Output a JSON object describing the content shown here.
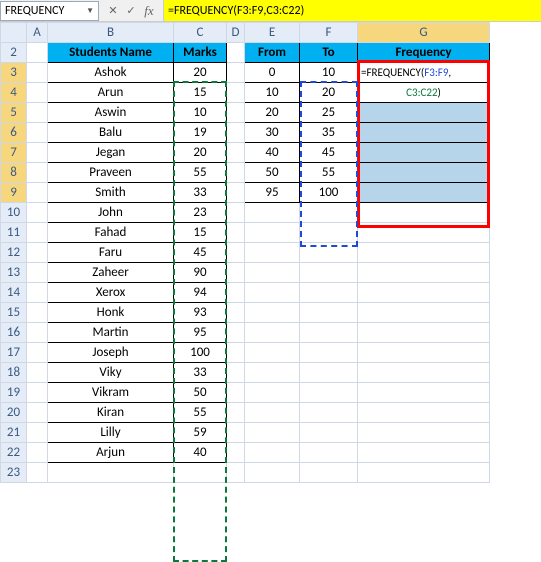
{
  "nameBox": "FREQUENCY",
  "formulaBar": "=FREQUENCY(F3:F9,C3:C22)",
  "formulaCell": {
    "prefix": "=FREQUENCY(",
    "ref1": "F3:F9",
    "comma": ",",
    "ref2": "C3:C22",
    "suffix": ")"
  },
  "headers": {
    "B": "Students Name",
    "C": "Marks",
    "E": "From",
    "F": "To",
    "G": "Frequency"
  },
  "cols": [
    "A",
    "B",
    "C",
    "D",
    "E",
    "F",
    "G"
  ],
  "students": [
    {
      "name": "Ashok",
      "marks": "20"
    },
    {
      "name": "Arun",
      "marks": "15"
    },
    {
      "name": "Aswin",
      "marks": "10"
    },
    {
      "name": "Balu",
      "marks": "19"
    },
    {
      "name": "Jegan",
      "marks": "20"
    },
    {
      "name": "Praveen",
      "marks": "55"
    },
    {
      "name": "Smith",
      "marks": "33"
    },
    {
      "name": "John",
      "marks": "23"
    },
    {
      "name": "Fahad",
      "marks": "15"
    },
    {
      "name": "Faru",
      "marks": "45"
    },
    {
      "name": "Zaheer",
      "marks": "90"
    },
    {
      "name": "Xerox",
      "marks": "94"
    },
    {
      "name": "Honk",
      "marks": "93"
    },
    {
      "name": "Martin",
      "marks": "95"
    },
    {
      "name": "Joseph",
      "marks": "100"
    },
    {
      "name": "Viky",
      "marks": "33"
    },
    {
      "name": "Vikram",
      "marks": "50"
    },
    {
      "name": "Kiran",
      "marks": "55"
    },
    {
      "name": "Lilly",
      "marks": "59"
    },
    {
      "name": "Arjun",
      "marks": "40"
    }
  ],
  "bins": [
    {
      "from": "0",
      "to": "10"
    },
    {
      "from": "10",
      "to": "20"
    },
    {
      "from": "20",
      "to": "25"
    },
    {
      "from": "30",
      "to": "35"
    },
    {
      "from": "40",
      "to": "45"
    },
    {
      "from": "50",
      "to": "55"
    },
    {
      "from": "95",
      "to": "100"
    }
  ],
  "icons": {
    "dd": "▼",
    "cancel": "✕",
    "accept": "✓",
    "fx": "fx"
  }
}
